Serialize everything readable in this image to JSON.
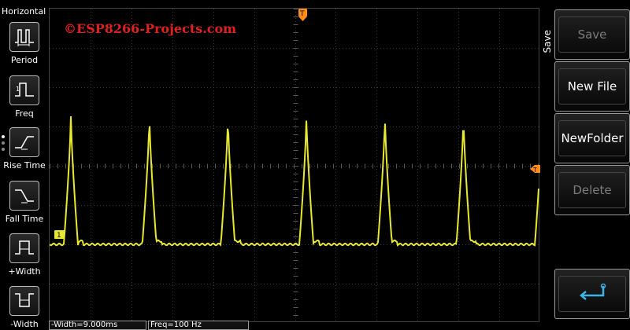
{
  "sidebar": {
    "title": "Horizontal",
    "items": [
      {
        "label": "Period",
        "icon": "period-icon"
      },
      {
        "label": "Freq",
        "icon": "frequency-icon"
      },
      {
        "label": "Rise Time",
        "icon": "rise-time-icon"
      },
      {
        "label": "Fall Time",
        "icon": "fall-time-icon"
      },
      {
        "label": "+Width",
        "icon": "positive-width-icon"
      },
      {
        "label": "-Width",
        "icon": "negative-width-icon"
      }
    ]
  },
  "screen": {
    "watermark": "©ESP8266-Projects.com",
    "channel_marker": "1",
    "trigger_marker": "T",
    "trace_color": "#e8e830",
    "marker_color": "#ff8c1a",
    "grid_color": "#3a3a3a"
  },
  "panel": {
    "title": "Save",
    "buttons": [
      {
        "label": "Save",
        "enabled": false
      },
      {
        "label": "New File",
        "enabled": true
      },
      {
        "label": "NewFolder",
        "enabled": true
      },
      {
        "label": "Delete",
        "enabled": false
      },
      {
        "label": "",
        "icon": "return-icon",
        "enabled": true
      }
    ]
  },
  "measurements": {
    "neg_width": "-Width=9.000ms",
    "freq": "Freq=100 Hz"
  }
}
